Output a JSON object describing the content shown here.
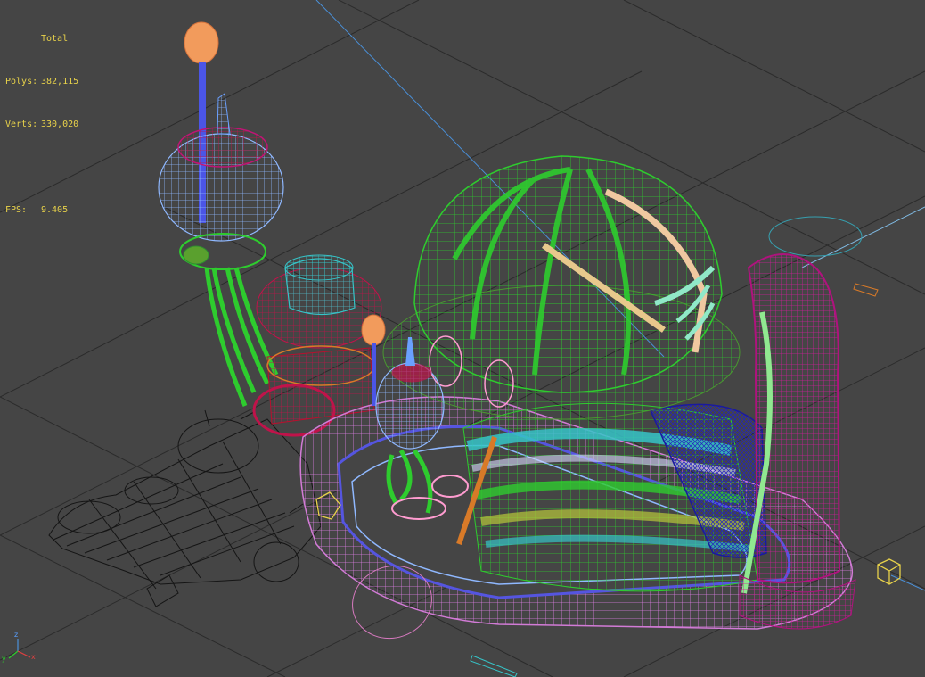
{
  "viewport": {
    "stats": {
      "title": "Total",
      "polys_label": "Polys:",
      "polys_value": "382,115",
      "verts_label": "Verts:",
      "verts_value": "330,020",
      "fps_label": "FPS:",
      "fps_value": "9.405"
    },
    "axis_gizmo": {
      "x": "x",
      "y": "y",
      "z": "z"
    },
    "colors": {
      "background": "#454545",
      "grid": "#2b2b2b",
      "stats_text": "#e8d24a",
      "dome": "#2ecc2e",
      "base_ring": "#d27bd6",
      "arch": "#b0127e",
      "blue_band": "#1a1a9e",
      "cyan": "#36c4c8",
      "orange_bulb": "#f29b5c",
      "light_blue_wire": "#8fb8ff",
      "crimson": "#c0134a",
      "vehicle": "#1a1a1a",
      "helper_yellow": "#e8d24a"
    }
  }
}
